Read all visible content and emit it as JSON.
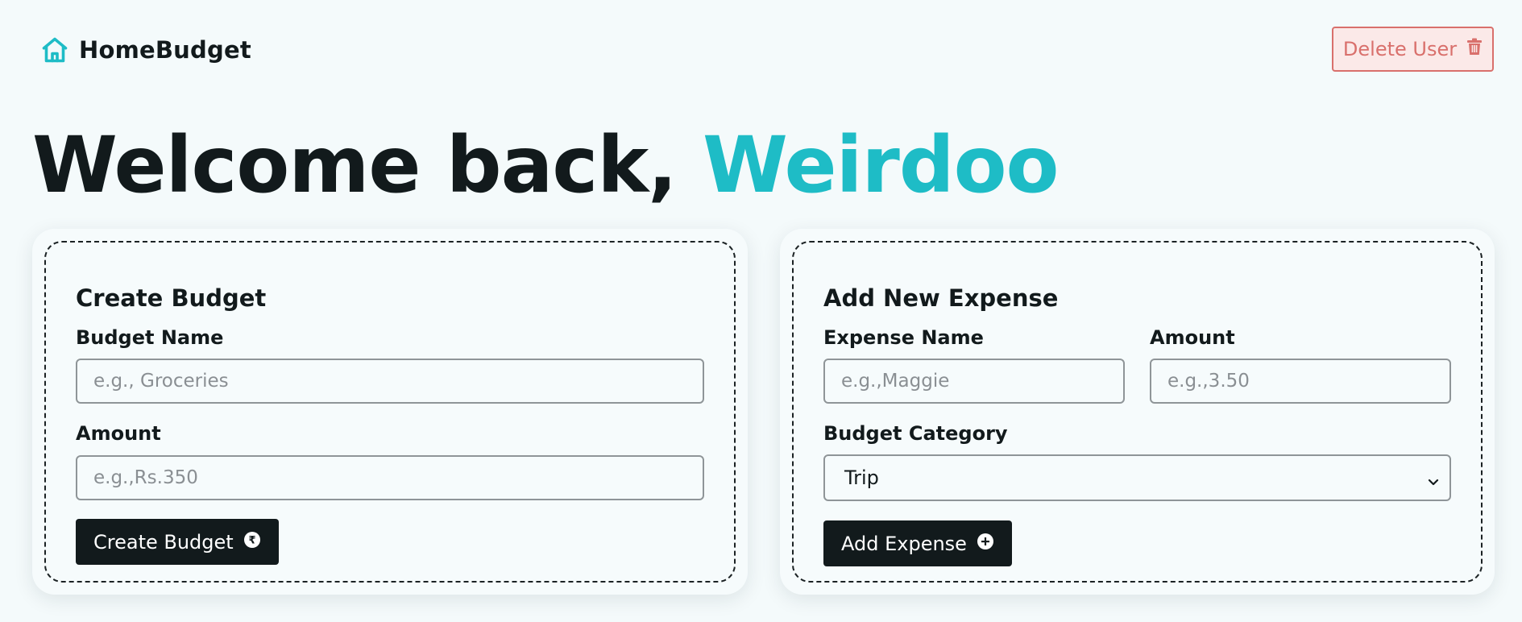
{
  "header": {
    "brand_name": "HomeBudget",
    "brand_icon": "home-icon",
    "delete_label": "Delete User",
    "delete_icon": "trash-icon"
  },
  "welcome": {
    "prefix": "Welcome back,",
    "username": "Weirdoo"
  },
  "create_budget": {
    "title": "Create Budget",
    "name_label": "Budget Name",
    "name_placeholder": "e.g., Groceries",
    "amount_label": "Amount",
    "amount_placeholder": "e.g.,Rs.350",
    "button_label": "Create Budget",
    "button_icon": "rupee-icon"
  },
  "add_expense": {
    "title": "Add New Expense",
    "name_label": "Expense Name",
    "name_placeholder": "e.g.,Maggie",
    "amount_label": "Amount",
    "amount_placeholder": "e.g.,3.50",
    "category_label": "Budget Category",
    "category_selected": "Trip",
    "button_label": "Add Expense",
    "button_icon": "plus-circle-icon"
  },
  "colors": {
    "background": "#f4fafb",
    "accent": "#1ebcc6",
    "danger": "#d9706c",
    "dark": "#121a1c"
  }
}
